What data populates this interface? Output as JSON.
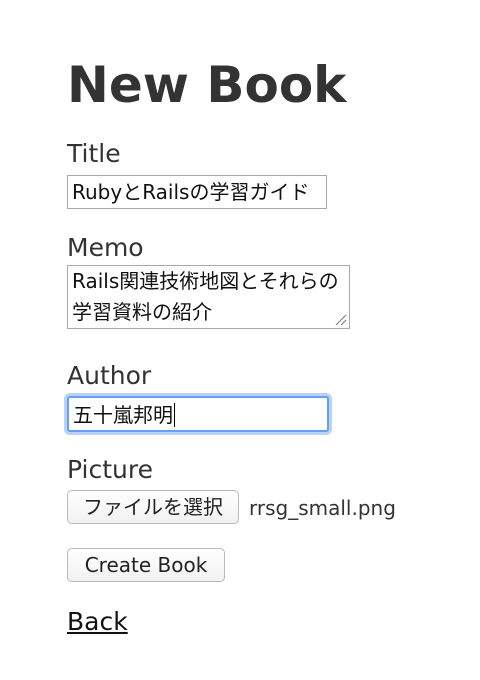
{
  "page": {
    "heading": "New Book"
  },
  "form": {
    "title": {
      "label": "Title",
      "value": "RubyとRailsの学習ガイド"
    },
    "memo": {
      "label": "Memo",
      "value": "Rails関連技術地図とそれらの学習資料の紹介"
    },
    "author": {
      "label": "Author",
      "value": "五十嵐邦明"
    },
    "picture": {
      "label": "Picture",
      "button_label": "ファイルを選択",
      "file_name": "rrsg_small.png"
    },
    "submit_label": "Create Book"
  },
  "back_link": "Back",
  "colors": {
    "focus_ring": "#6a9ef0",
    "text": "#333333"
  }
}
